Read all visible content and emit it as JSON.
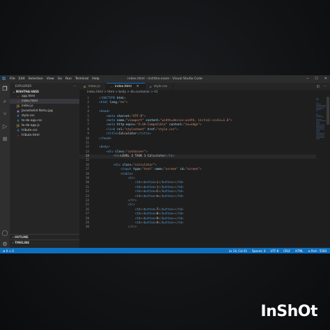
{
  "window": {
    "title": "index.html - nishtha-vsam - Visual Studio Code",
    "menu": [
      "File",
      "Edit",
      "Selection",
      "View",
      "Go",
      "Run",
      "Terminal",
      "Help"
    ]
  },
  "explorer": {
    "header": "EXPLORER",
    "folder": "NISHTHA-VASS",
    "files": [
      {
        "name": "app.html",
        "icon": "html-icon",
        "color": "#e44d26"
      },
      {
        "name": "index.html",
        "icon": "html-icon",
        "color": "#e44d26",
        "selected": true
      },
      {
        "name": "index.js",
        "icon": "js-icon",
        "color": "#e8d44d"
      },
      {
        "name": "Javashahid Nishu.jpg",
        "icon": "image-icon",
        "color": "#a074c4"
      },
      {
        "name": "style.css",
        "icon": "css-icon",
        "color": "#42a5f5"
      },
      {
        "name": "to-do-app.css",
        "icon": "css-icon",
        "color": "#42a5f5"
      },
      {
        "name": "to-do-app.js",
        "icon": "js-icon",
        "color": "#e8d44d"
      },
      {
        "name": "tribute.css",
        "icon": "css-icon",
        "color": "#42a5f5"
      },
      {
        "name": "tribute.html",
        "icon": "html-icon",
        "color": "#e44d26"
      }
    ],
    "outline": "OUTLINE",
    "timeline": "TIMELINE"
  },
  "tabs": [
    {
      "label": "index.js",
      "active": false
    },
    {
      "label": "index.html",
      "active": true
    },
    {
      "label": "style.css",
      "active": false
    }
  ],
  "breadcrumb": "index.html > html > body > div.container > h1",
  "code": {
    "current_line": 14,
    "lines": [
      [
        [
          "pu",
          "<!"
        ],
        [
          "tg",
          "DOCTYPE"
        ],
        [
          "at",
          " html"
        ],
        [
          "pu",
          ">"
        ]
      ],
      [
        [
          "pu",
          "<"
        ],
        [
          "tg",
          "html"
        ],
        [
          "at",
          " lang"
        ],
        [
          "pu",
          "="
        ],
        [
          "st",
          "\"en\""
        ],
        [
          "pu",
          ">"
        ]
      ],
      [],
      [
        [
          "pu",
          "<"
        ],
        [
          "tg",
          "head"
        ],
        [
          "pu",
          ">"
        ]
      ],
      [
        [
          "txt",
          "    "
        ],
        [
          "pu",
          "<"
        ],
        [
          "tg",
          "meta"
        ],
        [
          "at",
          " charset"
        ],
        [
          "pu",
          "="
        ],
        [
          "st",
          "\"UTF-8\""
        ],
        [
          "pu",
          ">"
        ]
      ],
      [
        [
          "txt",
          "    "
        ],
        [
          "pu",
          "<"
        ],
        [
          "tg",
          "meta"
        ],
        [
          "at",
          " name"
        ],
        [
          "pu",
          "="
        ],
        [
          "st",
          "\"viewport\""
        ],
        [
          "at",
          " content"
        ],
        [
          "pu",
          "="
        ],
        [
          "st",
          "\"width=device-width, initial-scale=1.0\""
        ],
        [
          "pu",
          ">"
        ]
      ],
      [
        [
          "txt",
          "    "
        ],
        [
          "pu",
          "<"
        ],
        [
          "tg",
          "meta"
        ],
        [
          "at",
          " http-equiv"
        ],
        [
          "pu",
          "="
        ],
        [
          "st",
          "\"X-UA-Compatible\""
        ],
        [
          "at",
          " content"
        ],
        [
          "pu",
          "="
        ],
        [
          "st",
          "\"ie=edge\""
        ],
        [
          "pu",
          ">"
        ]
      ],
      [
        [
          "txt",
          "    "
        ],
        [
          "pu",
          "<"
        ],
        [
          "tg",
          "link"
        ],
        [
          "at",
          " rel"
        ],
        [
          "pu",
          "="
        ],
        [
          "st",
          "\"stylesheet\""
        ],
        [
          "at",
          " href"
        ],
        [
          "pu",
          "="
        ],
        [
          "st",
          "\"style.css\""
        ],
        [
          "pu",
          ">"
        ]
      ],
      [
        [
          "txt",
          "    "
        ],
        [
          "pu",
          "<"
        ],
        [
          "tg",
          "title"
        ],
        [
          "pu",
          ">"
        ],
        [
          "txt",
          "Calculator"
        ],
        [
          "pu",
          "</"
        ],
        [
          "tg",
          "title"
        ],
        [
          "pu",
          ">"
        ]
      ],
      [
        [
          "pu",
          "</"
        ],
        [
          "tg",
          "head"
        ],
        [
          "pu",
          ">"
        ]
      ],
      [],
      [
        [
          "pu",
          "<"
        ],
        [
          "tg",
          "body"
        ],
        [
          "pu",
          ">"
        ]
      ],
      [
        [
          "txt",
          "    "
        ],
        [
          "pu",
          "<"
        ],
        [
          "tg",
          "div"
        ],
        [
          "at",
          " class"
        ],
        [
          "pu",
          "="
        ],
        [
          "st",
          "\"container\""
        ],
        [
          "pu",
          ">"
        ]
      ],
      [
        [
          "txt",
          "        "
        ],
        [
          "pu",
          "<"
        ],
        [
          "tg",
          "h1"
        ],
        [
          "pu",
          ">"
        ],
        [
          "txt",
          "LEVEL 2 TASK 1 Calculator"
        ],
        [
          "pu",
          "</"
        ],
        [
          "tg",
          "h1"
        ],
        [
          "pu",
          ">"
        ]
      ],
      [],
      [
        [
          "txt",
          "        "
        ],
        [
          "pu",
          "<"
        ],
        [
          "tg",
          "div"
        ],
        [
          "at",
          " class"
        ],
        [
          "pu",
          "="
        ],
        [
          "st",
          "\"calculator\""
        ],
        [
          "pu",
          ">"
        ]
      ],
      [
        [
          "txt",
          "            "
        ],
        [
          "pu",
          "<"
        ],
        [
          "tg",
          "input"
        ],
        [
          "at",
          " type"
        ],
        [
          "pu",
          "="
        ],
        [
          "st",
          "\"text\""
        ],
        [
          "at",
          " name"
        ],
        [
          "pu",
          "="
        ],
        [
          "st",
          "\"screen\""
        ],
        [
          "at",
          " id"
        ],
        [
          "pu",
          "="
        ],
        [
          "st",
          "\"screen\""
        ],
        [
          "pu",
          ">"
        ]
      ],
      [
        [
          "txt",
          "            "
        ],
        [
          "pu",
          "<"
        ],
        [
          "tg",
          "table"
        ],
        [
          "pu",
          ">"
        ]
      ],
      [
        [
          "txt",
          "                "
        ],
        [
          "pu",
          "<"
        ],
        [
          "tg",
          "tr"
        ],
        [
          "pu",
          ">"
        ]
      ],
      [
        [
          "txt",
          "                    "
        ],
        [
          "pu",
          "<"
        ],
        [
          "tg",
          "td"
        ],
        [
          "pu",
          "><"
        ],
        [
          "tg",
          "button"
        ],
        [
          "pu",
          ">"
        ],
        [
          "txt",
          "("
        ],
        [
          "pu",
          "</"
        ],
        [
          "tg",
          "button"
        ],
        [
          "pu",
          "></"
        ],
        [
          "tg",
          "td"
        ],
        [
          "pu",
          ">"
        ]
      ],
      [
        [
          "txt",
          "                    "
        ],
        [
          "pu",
          "<"
        ],
        [
          "tg",
          "td"
        ],
        [
          "pu",
          "><"
        ],
        [
          "tg",
          "button"
        ],
        [
          "pu",
          ">"
        ],
        [
          "txt",
          ")"
        ],
        [
          "pu",
          "</"
        ],
        [
          "tg",
          "button"
        ],
        [
          "pu",
          "></"
        ],
        [
          "tg",
          "td"
        ],
        [
          "pu",
          ">"
        ]
      ],
      [
        [
          "txt",
          "                    "
        ],
        [
          "pu",
          "<"
        ],
        [
          "tg",
          "td"
        ],
        [
          "pu",
          "><"
        ],
        [
          "tg",
          "button"
        ],
        [
          "pu",
          ">"
        ],
        [
          "txt",
          "C"
        ],
        [
          "pu",
          "</"
        ],
        [
          "tg",
          "button"
        ],
        [
          "pu",
          "></"
        ],
        [
          "tg",
          "td"
        ],
        [
          "pu",
          ">"
        ]
      ],
      [
        [
          "txt",
          "                    "
        ],
        [
          "pu",
          "<"
        ],
        [
          "tg",
          "td"
        ],
        [
          "pu",
          "><"
        ],
        [
          "tg",
          "button"
        ],
        [
          "pu",
          ">"
        ],
        [
          "txt",
          "%"
        ],
        [
          "pu",
          "</"
        ],
        [
          "tg",
          "button"
        ],
        [
          "pu",
          "></"
        ],
        [
          "tg",
          "td"
        ],
        [
          "pu",
          ">"
        ]
      ],
      [
        [
          "txt",
          "                "
        ],
        [
          "pu",
          "</"
        ],
        [
          "tg",
          "tr"
        ],
        [
          "pu",
          ">"
        ]
      ],
      [
        [
          "txt",
          "                "
        ],
        [
          "pu",
          "<"
        ],
        [
          "tg",
          "tr"
        ],
        [
          "pu",
          ">"
        ]
      ],
      [
        [
          "txt",
          "                    "
        ],
        [
          "pu",
          "<"
        ],
        [
          "tg",
          "td"
        ],
        [
          "pu",
          "><"
        ],
        [
          "tg",
          "button"
        ],
        [
          "pu",
          ">"
        ],
        [
          "txt",
          "7"
        ],
        [
          "pu",
          "</"
        ],
        [
          "tg",
          "button"
        ],
        [
          "pu",
          "></"
        ],
        [
          "tg",
          "td"
        ],
        [
          "pu",
          ">"
        ]
      ],
      [
        [
          "txt",
          "                    "
        ],
        [
          "pu",
          "<"
        ],
        [
          "tg",
          "td"
        ],
        [
          "pu",
          "><"
        ],
        [
          "tg",
          "button"
        ],
        [
          "pu",
          ">"
        ],
        [
          "txt",
          "8"
        ],
        [
          "pu",
          "</"
        ],
        [
          "tg",
          "button"
        ],
        [
          "pu",
          "></"
        ],
        [
          "tg",
          "td"
        ],
        [
          "pu",
          ">"
        ]
      ],
      [
        [
          "txt",
          "                    "
        ],
        [
          "pu",
          "<"
        ],
        [
          "tg",
          "td"
        ],
        [
          "pu",
          "><"
        ],
        [
          "tg",
          "button"
        ],
        [
          "pu",
          ">"
        ],
        [
          "txt",
          "9"
        ],
        [
          "pu",
          "</"
        ],
        [
          "tg",
          "button"
        ],
        [
          "pu",
          "></"
        ],
        [
          "tg",
          "td"
        ],
        [
          "pu",
          ">"
        ]
      ],
      [
        [
          "txt",
          "                    "
        ],
        [
          "pu",
          "<"
        ],
        [
          "tg",
          "td"
        ],
        [
          "pu",
          "><"
        ],
        [
          "tg",
          "button"
        ],
        [
          "pu",
          ">"
        ],
        [
          "txt",
          "X"
        ],
        [
          "pu",
          "</"
        ],
        [
          "tg",
          "button"
        ],
        [
          "pu",
          "></"
        ],
        [
          "tg",
          "td"
        ],
        [
          "pu",
          ">"
        ]
      ],
      [
        [
          "txt",
          "                "
        ],
        [
          "pu",
          "</"
        ],
        [
          "tg",
          "tr"
        ],
        [
          "pu",
          ">"
        ]
      ]
    ]
  },
  "status": {
    "left": [
      "⊗ 0  ⚠ 0"
    ],
    "right": [
      "Ln 14, Col 41",
      "Spaces: 4",
      "UTF-8",
      "CRLF",
      "HTML",
      "⊘ Port : 5500"
    ]
  },
  "watermark": "InShOt",
  "colors": {
    "accent": "#0e6fbf",
    "editor_bg": "#1e1e1e",
    "sidebar_bg": "#252526"
  }
}
